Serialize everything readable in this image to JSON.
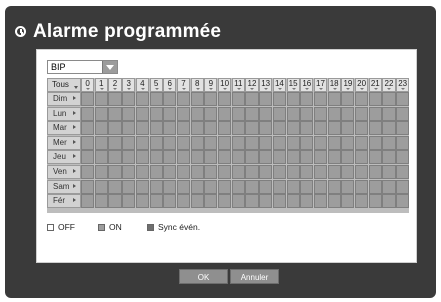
{
  "window": {
    "title": "Alarme programmée"
  },
  "select": {
    "value": "BIP"
  },
  "grid": {
    "all_label": "Tous",
    "hours": [
      "0",
      "1",
      "2",
      "3",
      "4",
      "5",
      "6",
      "7",
      "8",
      "9",
      "10",
      "11",
      "12",
      "13",
      "14",
      "15",
      "16",
      "17",
      "18",
      "19",
      "20",
      "21",
      "22",
      "23"
    ],
    "days": [
      "Dim",
      "Lun",
      "Mar",
      "Mer",
      "Jeu",
      "Ven",
      "Sam",
      "Fér"
    ]
  },
  "legend": {
    "off": "OFF",
    "on": "ON",
    "sync": "Sync évén.",
    "colors": {
      "off": "#ffffff",
      "on": "#9d9d9d",
      "sync": "#6f6f6f"
    }
  },
  "buttons": {
    "ok": "OK",
    "cancel": "Annuler"
  }
}
